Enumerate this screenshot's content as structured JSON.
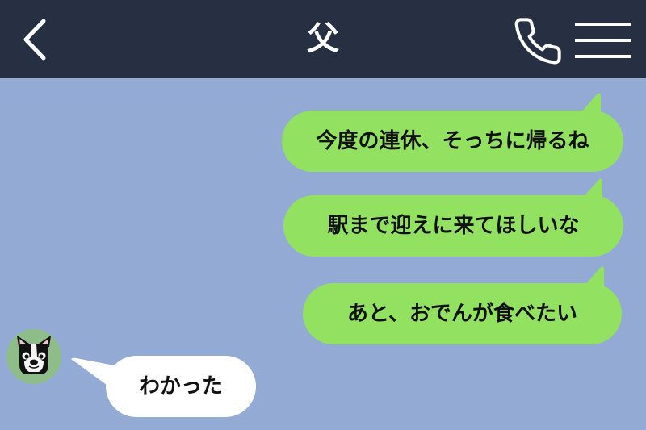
{
  "header": {
    "title": "父",
    "back_icon": "chevron-left-icon",
    "call_icon": "phone-icon",
    "menu_icon": "hamburger-menu-icon"
  },
  "messages": [
    {
      "side": "sent",
      "text": "今度の連休、そっちに帰るね"
    },
    {
      "side": "sent",
      "text": "駅まで迎えに来てほしいな"
    },
    {
      "side": "sent",
      "text": "あと、おでんが食べたい"
    },
    {
      "side": "received",
      "text": "わかった",
      "avatar": "boston-terrier-dog-icon"
    }
  ],
  "colors": {
    "header_bg": "#273043",
    "chat_bg": "#93abd4",
    "sent_bubble": "#93e160",
    "received_bubble": "#ffffff",
    "avatar_bg": "#8fbd8a"
  }
}
